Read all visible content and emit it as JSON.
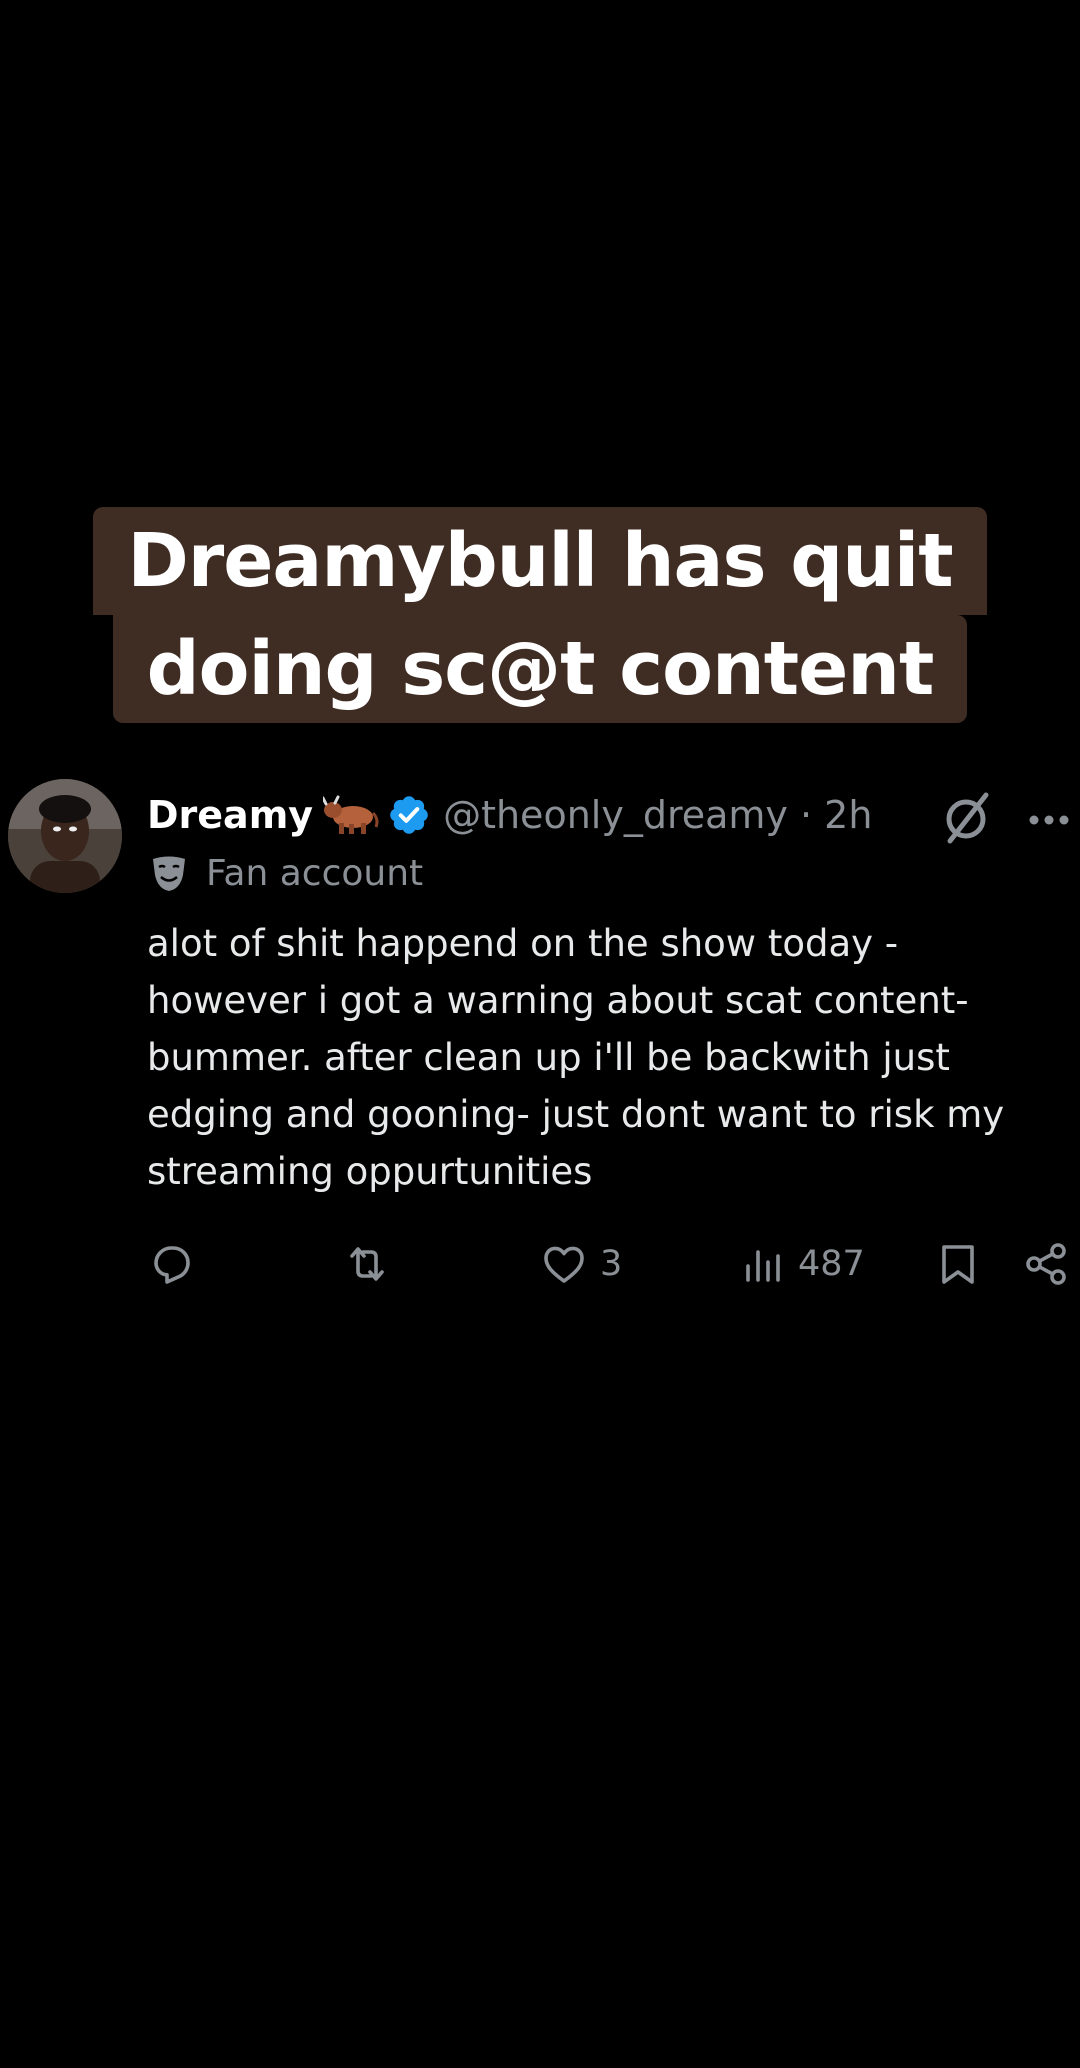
{
  "caption": {
    "line1": "Dreamybull has quit",
    "line2": "doing sc@t content"
  },
  "tweet": {
    "author_name": "Dreamy",
    "author_handle": "@theonly_dreamy · 2h",
    "label": "Fan account",
    "text": "alot of shit happend on the show today -\nhowever i got a warning about scat content-\nbummer. after clean up i'll be backwith just\nedging and gooning- just dont want to risk my\nstreaming oppurtunities",
    "likes": "3",
    "views": "487"
  },
  "colors": {
    "background": "#000000",
    "caption_bg": "#3f2d24",
    "verified": "#1d9bf0",
    "muted": "#8b9096"
  },
  "icons": [
    "bull-icon",
    "verified-badge-icon",
    "grok-icon",
    "more-icon",
    "theater-mask-icon",
    "reply-icon",
    "retweet-icon",
    "like-icon",
    "views-icon",
    "bookmark-icon",
    "share-icon"
  ]
}
